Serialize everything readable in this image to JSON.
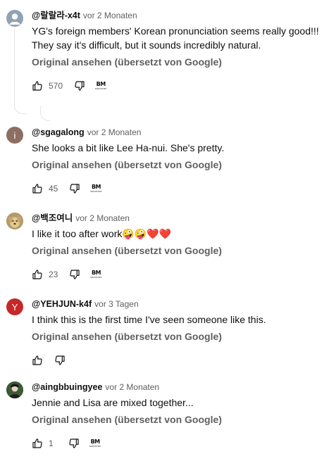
{
  "comments": [
    {
      "author": "@랄랄라-x4t",
      "time": "vor 2 Monaten",
      "text": "YG's foreign members' Korean pronunciation seems really good!!! They say it's difficult, but it sounds incredibly natural.",
      "translate_label": "Original ansehen (übersetzt von Google)",
      "likes": "570",
      "avatar_color": "#8fa3b3",
      "avatar_letter": ""
    },
    {
      "author": "@sgagalong",
      "time": "vor 2 Monaten",
      "text": "She looks a bit like Lee Ha-nui. She's pretty.",
      "translate_label": "Original ansehen (übersetzt von Google)",
      "likes": "45",
      "avatar_color": "#8d6e63",
      "avatar_letter": "i"
    },
    {
      "author": "@백조여니",
      "time": "vor 2 Monaten",
      "text": "I like it too after work🤪🤪❤️❤️",
      "translate_label": "Original ansehen (übersetzt von Google)",
      "likes": "23",
      "avatar_color": "#c9b48a",
      "avatar_letter": ""
    },
    {
      "author": "@YEHJUN-k4f",
      "time": "vor 3 Tagen",
      "text": "I think this is the first time I've seen someone like this.",
      "translate_label": "Original ansehen (übersetzt von Google)",
      "likes": "",
      "avatar_color": "#c62828",
      "avatar_letter": "Y"
    },
    {
      "author": "@aingbbuingyee",
      "time": "vor 2 Monaten",
      "text": "Jennie and Lisa are mixed together...",
      "translate_label": "Original ansehen (übersetzt von Google)",
      "likes": "1",
      "avatar_color": "#2e4a2b",
      "avatar_letter": ""
    }
  ],
  "creator_badge": {
    "mark": "BM",
    "sub": "MONSTRZ"
  },
  "colors": {
    "text": "#0f0f0f",
    "secondary": "#606060",
    "line": "#e5e5e5"
  }
}
